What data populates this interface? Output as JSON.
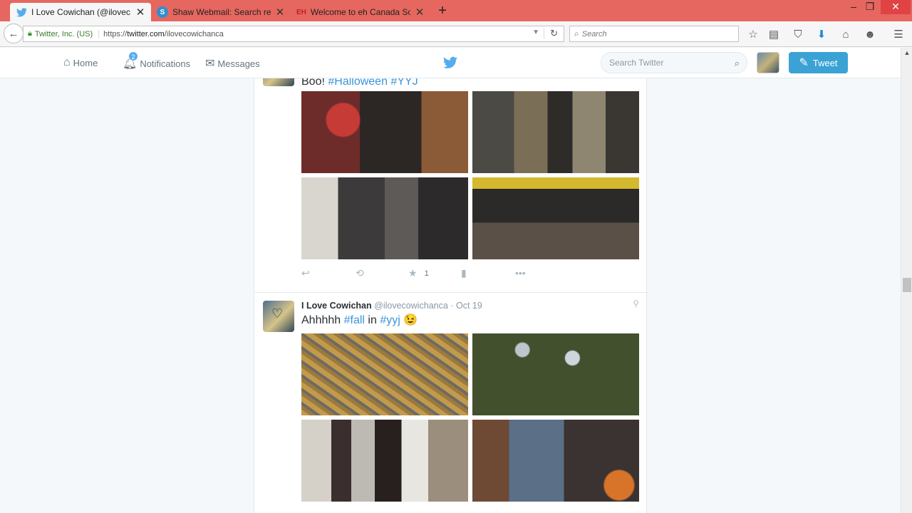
{
  "browser": {
    "tabs": [
      {
        "title": "I Love Cowichan (@ilovec...",
        "favicon": "twitter-bird-icon",
        "active": true
      },
      {
        "title": "Shaw Webmail: Search res...",
        "favicon": "shaw-s-icon",
        "active": false
      },
      {
        "title": "Welcome to eh Canada So...",
        "favicon": "eh-icon",
        "favicon_text": "EH",
        "active": false
      }
    ],
    "new_tab_label": "+",
    "identity": "Twitter, Inc. (US)",
    "url_prefix": "https://",
    "url_host": "twitter.com",
    "url_path": "/ilovecowichanca",
    "search_placeholder": "Search",
    "accent": "#e6675f"
  },
  "twitter": {
    "nav": {
      "home": "Home",
      "notifications": "Notifications",
      "notifications_count": "2",
      "messages": "Messages"
    },
    "search_placeholder": "Search Twitter",
    "tweet_button": "Tweet",
    "brand_color": "#55acee"
  },
  "tweets": [
    {
      "text_prefix": "Boo! ",
      "hashtags": [
        "#Halloween",
        "#YYJ"
      ],
      "photos": [
        "clown-photo",
        "skeletons-photo",
        "witch-photo",
        "caution-tape-photo"
      ],
      "likes": "1"
    },
    {
      "name": "I Love Cowichan",
      "handle": "@ilovecowichanca",
      "dot": "·",
      "time": "Oct 19",
      "text_prefix": "Ahhhhh ",
      "hashtag1": "#fall",
      "text_mid": " in ",
      "hashtag2": "#yyj",
      "emoji": "😉",
      "photos": [
        "leaves-photo",
        "tree-photo",
        "costumes-photo",
        "rocking-chair-photo"
      ]
    }
  ]
}
